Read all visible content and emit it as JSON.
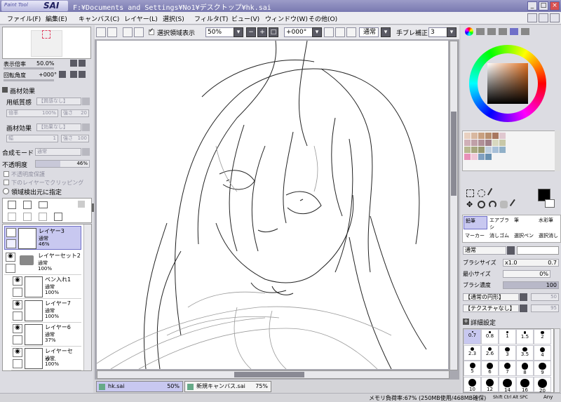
{
  "titlebar": {
    "logo_small": "Paint Tool",
    "logo_big": "SAI",
    "title": "F:¥Documents and Settings¥No1¥デスクトップ¥hk.sai"
  },
  "menu": [
    "ファイル(F)",
    "編集(E)",
    "キャンバス(C)",
    "レイヤー(L)",
    "選択(S)",
    "フィルタ(T)",
    "ビュー(V)",
    "ウィンドウ(W)",
    "その他(O)"
  ],
  "toolbar": {
    "selection_display": "選択領域表示",
    "zoom": "50%",
    "rotation": "+000°",
    "mode": "通常",
    "stabilizer_label": "手ブレ補正",
    "stabilizer_value": "3"
  },
  "navigator": {
    "zoom_label": "表示倍率",
    "zoom_value": "50.0%",
    "rotate_label": "回転角度",
    "rotate_value": "+000°"
  },
  "effects": {
    "header": "画材効果",
    "paper_label": "用紙質感",
    "paper_value": "【質感なし】",
    "scale_label": "倍率",
    "scale_value": "100%",
    "strength_label": "強さ",
    "strength_value": "20",
    "effect_label": "画材効果",
    "effect_value": "【効果なし】",
    "width_label": "幅",
    "width_value": "1",
    "strength2_value": "100"
  },
  "layer_props": {
    "blend_label": "合成モード",
    "blend_value": "通常",
    "opacity_label": "不透明度",
    "opacity_value": "46%",
    "protect_opacity": "不透明度保護",
    "clip_lower": "下のレイヤーでクリッピング",
    "selection_source": "領域検出元に指定"
  },
  "layers": [
    {
      "name": "レイヤー3",
      "mode": "通常",
      "opacity": "46%"
    },
    {
      "name": "レイヤーセット2",
      "mode": "通常",
      "opacity": "100%"
    },
    {
      "name": "ペン入れ1",
      "mode": "通常",
      "opacity": "100%"
    },
    {
      "name": "レイヤー7",
      "mode": "通常",
      "opacity": "100%"
    },
    {
      "name": "レイヤー6",
      "mode": "通常",
      "opacity": "37%"
    },
    {
      "name": "レイヤーセッ...",
      "mode": "通常",
      "opacity": "100%"
    }
  ],
  "tools": {
    "row1": [
      "鉛筆",
      "エアブラシ",
      "筆",
      "水彩筆"
    ],
    "row2": [
      "マーカー",
      "消しゴム",
      "選択ペン",
      "選択消し"
    ]
  },
  "brush": {
    "mode": "通常",
    "size_label": "ブラシサイズ",
    "size_mult": "x1.0",
    "size_value": "0.7",
    "min_size_label": "最小サイズ",
    "min_size_value": "0%",
    "density_label": "ブラシ濃度",
    "density_value": "100",
    "shape": "【通常の円形】",
    "shape_value": "50",
    "texture": "【テクスチャなし】",
    "texture_value": "95",
    "detail": "詳細設定",
    "sizes": [
      "0.7",
      "0.8",
      "1",
      "1.5",
      "2",
      "2.3",
      "2.6",
      "3",
      "3.5",
      "4",
      "5",
      "6",
      "7",
      "8",
      "9",
      "10",
      "12",
      "14",
      "16",
      "20"
    ]
  },
  "documents": [
    {
      "name": "hk.sai",
      "zoom": "50%"
    },
    {
      "name": "新規キャンバス.sai",
      "zoom": "75%"
    }
  ],
  "status": {
    "memory": "メモリ負荷率:67% (250MB使用/468MB確保)",
    "keys": "Shift Ctrl Alt SPC",
    "any": "Any"
  },
  "palette_colors": [
    "#e8d0c0",
    "#d8b8a0",
    "#c8a080",
    "#b89070",
    "#a87860",
    "#e0c8d0",
    "#d0b0b8",
    "#c0a0a8",
    "#b09098",
    "#a08088",
    "#d8d8c0",
    "#c8c8a8",
    "#b8b890",
    "#a8a880",
    "#989870",
    "#c0d0e0",
    "#a8c0d8",
    "#90b0c8",
    "#e890b8",
    "#f0c8d8",
    "#80a0c0",
    "#6890b0"
  ],
  "colors": {
    "accent": "#7070c8",
    "primary_color": "#000000",
    "secondary_color": "#ffffff"
  }
}
